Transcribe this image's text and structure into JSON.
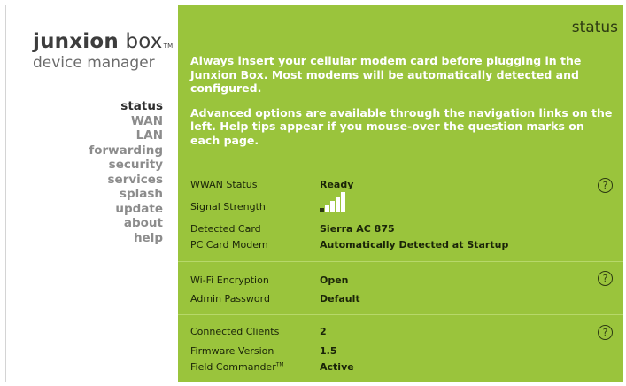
{
  "logo": {
    "brand_bold": "junxion",
    "brand_rest": " box",
    "tm": "TM",
    "subtitle": "device manager"
  },
  "nav": {
    "items": [
      {
        "label": "status",
        "active": true
      },
      {
        "label": "WAN"
      },
      {
        "label": "LAN"
      },
      {
        "label": "forwarding"
      },
      {
        "label": "security"
      },
      {
        "label": "services"
      },
      {
        "label": "splash"
      },
      {
        "label": "update"
      },
      {
        "label": "about"
      },
      {
        "label": "help"
      }
    ]
  },
  "panel": {
    "title": "status",
    "intro_1": "Always insert your cellular modem card before plugging in the Junxion Box. Most modems will be automatically detected and configured.",
    "intro_2": "Advanced options are available through the navigation links on the left. Help tips appear if you mouse-over the question marks on each page.",
    "help_glyph": "?",
    "section1": {
      "wwan_status_label": "WWAN Status",
      "wwan_status_value": "Ready",
      "signal_label": "Signal Strength",
      "signal_bars_lit": 4,
      "signal_bars_total": 5,
      "card_label": "Detected Card",
      "card_value": "Sierra AC 875",
      "modem_label": "PC Card Modem",
      "modem_value": "Automatically Detected at Startup"
    },
    "section2": {
      "wifi_label": "Wi-Fi Encryption",
      "wifi_value": "Open",
      "admin_label": "Admin Password",
      "admin_value": "Default"
    },
    "section3": {
      "clients_label": "Connected Clients",
      "clients_value": "2",
      "firmware_label": "Firmware Version",
      "firmware_value": "1.5",
      "commander_label": "Field Commander",
      "commander_tm": "TM",
      "commander_value": "Active"
    }
  },
  "colors": {
    "panel_green": "#9ac43c",
    "active_nav": "#2e2e2e",
    "inactive_nav": "#8c8c8c"
  }
}
